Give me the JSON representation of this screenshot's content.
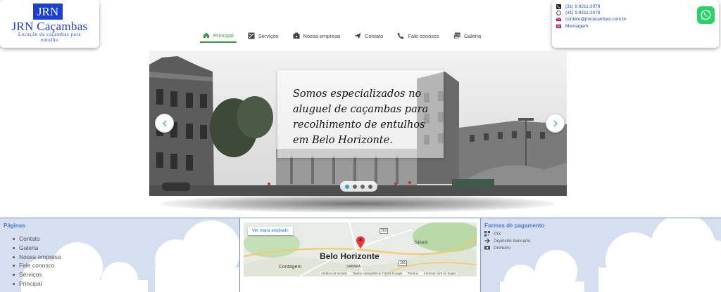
{
  "brand": {
    "mark": "JRN",
    "name": "JRN Caçambas",
    "tagline": "Locação de caçambas para entulho"
  },
  "nav": [
    {
      "label": "Principal",
      "icon": "home-icon",
      "active": true
    },
    {
      "label": "Serviços",
      "icon": "tools-icon"
    },
    {
      "label": "Nossa empresa",
      "icon": "building-icon"
    },
    {
      "label": "Contato",
      "icon": "paper-plane-icon"
    },
    {
      "label": "Fale conosco",
      "icon": "phone-icon"
    },
    {
      "label": "Galeria",
      "icon": "images-icon"
    }
  ],
  "contact": {
    "phone": "(31) 9 9211-2078",
    "whatsapp": "(31) 9 9211-2078",
    "email": "contato@jrncacambas.com.br",
    "message": "Mensagem"
  },
  "hero": {
    "caption": "Somos especializados no aluguel de caçambas para recolhimento de entulhos em Belo Horizonte.",
    "slides": 4,
    "active_slide": 1
  },
  "footer": {
    "pages_title": "Páginas",
    "pages": [
      "Contato",
      "Galeria",
      "Nossa empresa",
      "Fale conosco",
      "Serviços",
      "Principal"
    ],
    "map": {
      "button": "Ver mapa ampliado",
      "city": "Belo Horizonte",
      "labels": [
        "Contagem",
        "Sabará",
        "SABARÁ",
        "262",
        "381"
      ],
      "attribution": [
        "Atalhos do teclado",
        "Dados cartográficos ©2024 Google",
        "Termos",
        "Informar erro no mapa"
      ]
    },
    "payments_title": "Formas de pagamento",
    "payments": [
      {
        "label": "PIX",
        "icon": "qr-icon"
      },
      {
        "label": "Depósito bancário",
        "icon": "arrow-right-icon"
      },
      {
        "label": "Dinheiro",
        "icon": "cash-icon"
      }
    ]
  },
  "colors": {
    "brand_blue": "#1b3fd1",
    "nav_active": "#2e9e44",
    "link_blue": "#1a47c8",
    "footer_bg": "#d5dff0",
    "footer_title": "#4a78c8",
    "whatsapp": "#25d366"
  }
}
